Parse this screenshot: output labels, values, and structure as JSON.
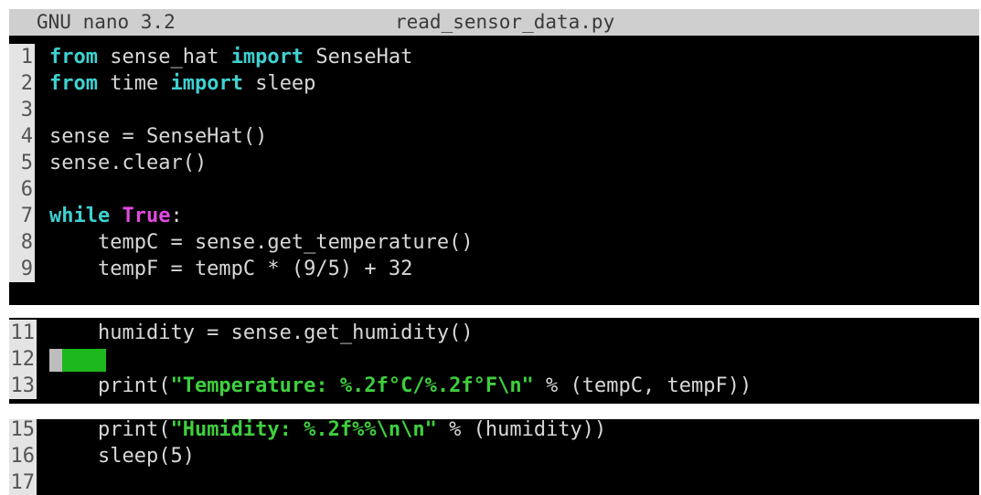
{
  "titlebar": {
    "app": "GNU nano 3.2",
    "filename": "read_sensor_data.py"
  },
  "panel1": [
    {
      "num": "1",
      "parts": [
        [
          "kw",
          "from"
        ],
        [
          "",
          " sense_hat "
        ],
        [
          "kw",
          "import"
        ],
        [
          "",
          " SenseHat"
        ]
      ]
    },
    {
      "num": "2",
      "parts": [
        [
          "kw",
          "from"
        ],
        [
          "",
          " time "
        ],
        [
          "kw",
          "import"
        ],
        [
          "",
          " sleep"
        ]
      ]
    },
    {
      "num": "3",
      "parts": []
    },
    {
      "num": "4",
      "parts": [
        [
          "",
          "sense = SenseHat()"
        ]
      ]
    },
    {
      "num": "5",
      "parts": [
        [
          "",
          "sense.clear()"
        ]
      ]
    },
    {
      "num": "6",
      "parts": []
    },
    {
      "num": "7",
      "parts": [
        [
          "kw",
          "while"
        ],
        [
          "",
          " "
        ],
        [
          "tru",
          "True"
        ],
        [
          "",
          ":"
        ]
      ]
    },
    {
      "num": "8",
      "parts": [
        [
          "",
          "    tempC = sense.get_temperature()"
        ]
      ]
    },
    {
      "num": "9",
      "parts": [
        [
          "",
          "    tempF = tempC * (9/5) + 32"
        ]
      ]
    }
  ],
  "panel2": [
    {
      "num": "11",
      "parts": [
        [
          "",
          "    humidity = sense.get_humidity()"
        ]
      ]
    },
    {
      "num": "12",
      "parts": [],
      "cursor": true
    },
    {
      "num": "13",
      "parts": [
        [
          "",
          "    print("
        ],
        [
          "str",
          "\"Temperature: %.2f°C/%.2f°F\\n\""
        ],
        [
          "",
          " % (tempC, tempF))"
        ]
      ]
    }
  ],
  "panel3": [
    {
      "num": "15",
      "parts": [
        [
          "",
          "    print("
        ],
        [
          "str",
          "\"Humidity: %.2f%%\\n\\n\""
        ],
        [
          "",
          " % (humidity))"
        ]
      ]
    },
    {
      "num": "16",
      "parts": [
        [
          "",
          "    sleep(5)"
        ]
      ]
    },
    {
      "num": "17",
      "parts": []
    }
  ],
  "colors": {
    "keyword": "#3fd1d1",
    "constant": "#e04be0",
    "string": "#3ecf3e",
    "text": "#d8d8d8",
    "background": "#000000"
  }
}
